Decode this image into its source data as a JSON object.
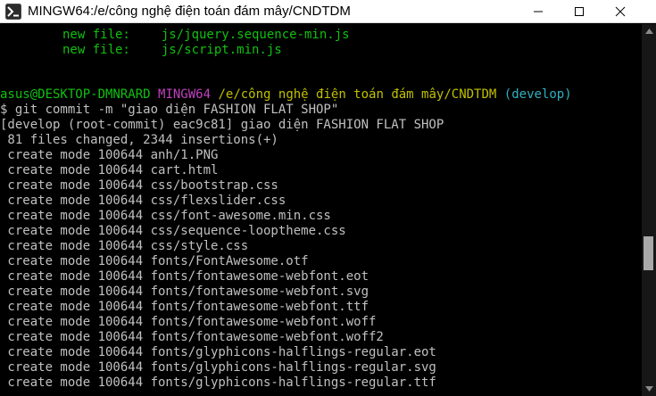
{
  "window": {
    "title": "MINGW64:/e/công nghệ điện toán đám mây/CNDTDM",
    "icons": {
      "app": "git-bash-icon",
      "minimize": "minimize-icon",
      "maximize": "maximize-icon",
      "close": "close-icon"
    }
  },
  "terminal": {
    "new_file_1": {
      "label": "new file:",
      "path": "js/jquery.sequence-min.js"
    },
    "new_file_2": {
      "label": "new file:",
      "path": "js/script.min.js"
    },
    "prompt": {
      "user_host": "asus@DESKTOP-DMNRARD",
      "shell": "MINGW64",
      "path": "/e/công nghệ điện toán đám mây/CNDTDM",
      "branch": "(develop)"
    },
    "command": "$ git commit -m \"giao diện FASHION FLAT SHOP\"",
    "output": [
      "[develop (root-commit) eac9c81] giao diện FASHION FLAT SHOP",
      " 81 files changed, 2344 insertions(+)",
      " create mode 100644 anh/1.PNG",
      " create mode 100644 cart.html",
      " create mode 100644 css/bootstrap.css",
      " create mode 100644 css/flexslider.css",
      " create mode 100644 css/font-awesome.min.css",
      " create mode 100644 css/sequence-looptheme.css",
      " create mode 100644 css/style.css",
      " create mode 100644 fonts/FontAwesome.otf",
      " create mode 100644 fonts/fontawesome-webfont.eot",
      " create mode 100644 fonts/fontawesome-webfont.svg",
      " create mode 100644 fonts/fontawesome-webfont.ttf",
      " create mode 100644 fonts/fontawesome-webfont.woff",
      " create mode 100644 fonts/fontawesome-webfont.woff2",
      " create mode 100644 fonts/glyphicons-halflings-regular.eot",
      " create mode 100644 fonts/glyphicons-halflings-regular.svg",
      " create mode 100644 fonts/glyphicons-halflings-regular.ttf"
    ]
  },
  "scrollbar": {
    "up_icon": "scroll-up-arrow-icon",
    "down_icon": "scroll-down-arrow-icon",
    "position_fraction": 0.62
  }
}
